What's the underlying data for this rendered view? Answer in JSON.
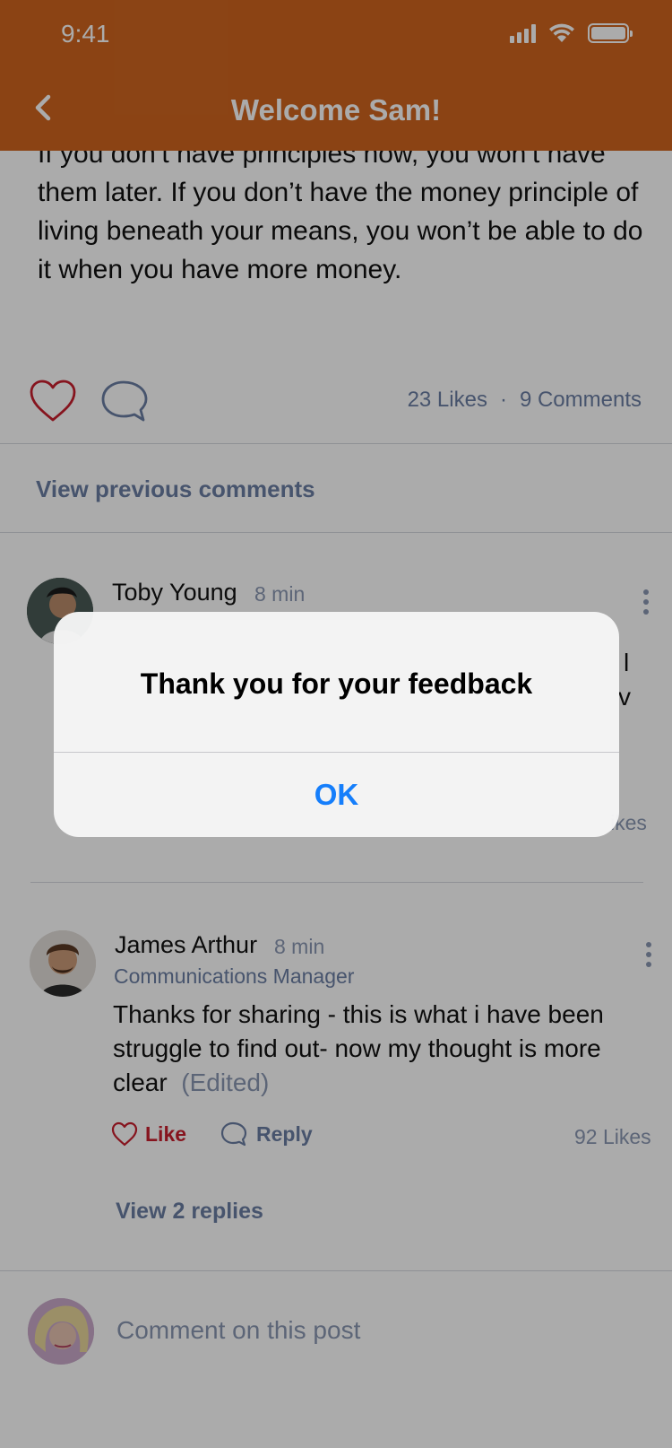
{
  "status_bar": {
    "time": "9:41"
  },
  "header": {
    "title": "Welcome Sam!"
  },
  "post": {
    "text": "If you don’t have principles now, you won’t have them later. If you don’t have the money principle of living beneath your means, you won’t be able to do it when you have more money.",
    "likes": "23 Likes",
    "separator": "·",
    "comments": "9 Comments"
  },
  "view_previous": "View previous comments",
  "comments": [
    {
      "author": "Toby Young",
      "time": "8 min",
      "body_fragment_1": "l",
      "body_fragment_2": "v",
      "likes_fragment": "ikes"
    },
    {
      "author": "James Arthur",
      "time": "8 min",
      "role": "Communications Manager",
      "body": "Thanks for sharing - this is what i have been struggle to find out- now my thought is more clear",
      "edited": "(Edited)",
      "like_label": "Like",
      "reply_label": "Reply",
      "likes": "92 Likes",
      "view_replies": "View 2 replies"
    }
  ],
  "comment_input": {
    "placeholder": "Comment on this post"
  },
  "alert": {
    "title": "Thank you for your feedback",
    "ok_label": "OK"
  },
  "colors": {
    "header": "#d0651f",
    "accent_blue": "#157efb",
    "like_red": "#c81f2d",
    "muted_blue": "#6b7ea3"
  }
}
